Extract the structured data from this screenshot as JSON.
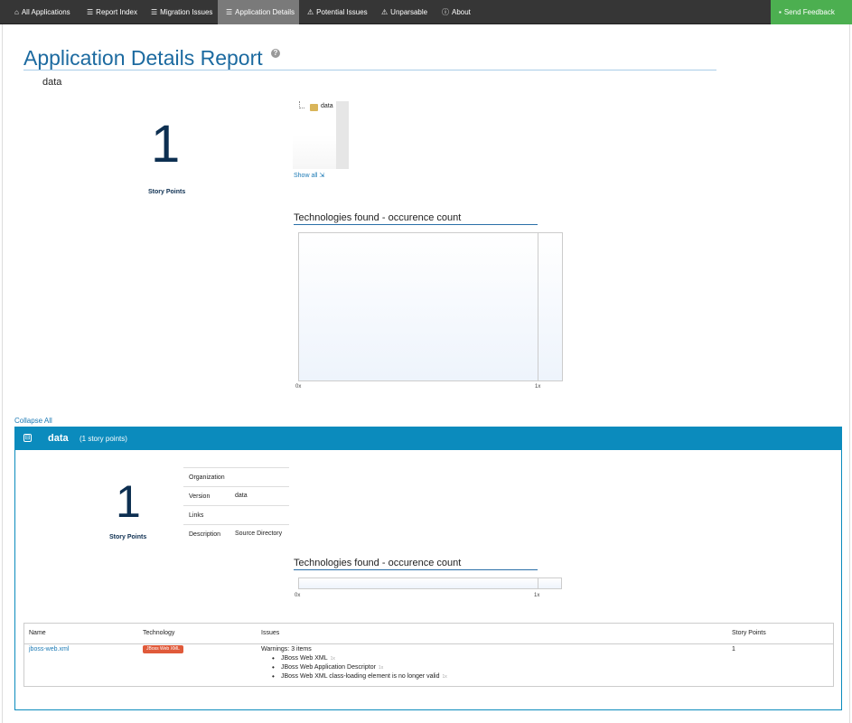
{
  "nav": {
    "items": [
      {
        "label": "All Applications",
        "icon": "home-icon"
      },
      {
        "label": "Report Index",
        "icon": "list-icon"
      },
      {
        "label": "Migration Issues",
        "icon": "list-icon"
      },
      {
        "label": "Application Details",
        "icon": "list-icon"
      },
      {
        "label": "Potential Issues",
        "icon": "warning-icon"
      },
      {
        "label": "Unparsable",
        "icon": "warning-icon"
      },
      {
        "label": "About",
        "icon": "info-icon"
      }
    ],
    "feedback": "Send Feedback"
  },
  "header": {
    "title": "Application Details Report",
    "help": "?",
    "app_name": "data"
  },
  "summary": {
    "story_points": "1",
    "story_points_label": "Story Points",
    "tree_item": "data",
    "show_all": "Show all"
  },
  "tech_chart_1": {
    "title": "Technologies found - occurence count",
    "tick_start": "0x",
    "tick_end": "1x"
  },
  "collapse_all": "Collapse All",
  "panel": {
    "toggle": "⊟",
    "title": "data",
    "subtitle": "(1 story points)",
    "story_points": "1",
    "story_points_label": "Story Points",
    "info": [
      {
        "key": "Organization",
        "value": ""
      },
      {
        "key": "Version",
        "value": "data"
      },
      {
        "key": "Links",
        "value": ""
      },
      {
        "key": "Description",
        "value": "Source Directory"
      }
    ],
    "tech_chart": {
      "title": "Technologies found - occurence count",
      "tick_start": "0x",
      "tick_end": "1x"
    },
    "table": {
      "headers": [
        "Name",
        "Technology",
        "Issues",
        "Story Points"
      ],
      "row": {
        "name": "jboss-web.xml",
        "technology": "JBoss Web XML",
        "warnings": "Warnings: 3 items",
        "issues": [
          {
            "text": "JBoss Web XML",
            "count": "1x"
          },
          {
            "text": "JBoss Web Application Descriptor",
            "count": "1x"
          },
          {
            "text": "JBoss Web XML class-loading element is no longer valid",
            "count": "1x"
          }
        ],
        "story_points": "1"
      }
    }
  },
  "colors": {
    "nav_bg": "#363636",
    "nav_active": "#7a7a7a",
    "feedback": "#4caf50",
    "title": "#1c6aa0",
    "panel": "#0b8bbd",
    "badge": "#e05a3a"
  }
}
